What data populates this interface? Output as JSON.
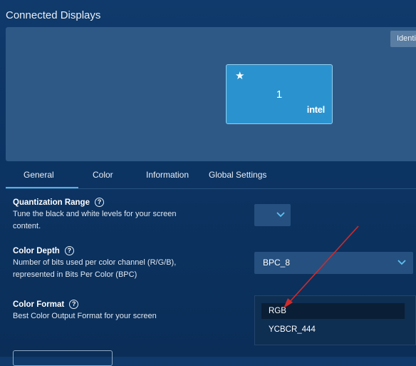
{
  "header": {
    "title": "Connected Displays"
  },
  "preview": {
    "identify_label": "Identify",
    "display": {
      "number": "1",
      "brand": "intel",
      "primary_icon": "star-icon"
    }
  },
  "tabs": [
    {
      "label": "General",
      "active": true
    },
    {
      "label": "Color",
      "active": false
    },
    {
      "label": "Information",
      "active": false
    },
    {
      "label": "Global Settings",
      "active": false
    }
  ],
  "settings": {
    "quantization": {
      "title": "Quantization Range",
      "description": "Tune the black and white levels for your screen content.",
      "value": ""
    },
    "color_depth": {
      "title": "Color Depth",
      "description": "Number of bits used per color channel (R/G/B), represented in Bits Per Color (BPC)",
      "value": "BPC_8"
    },
    "color_format": {
      "title": "Color Format",
      "description": "Best Color Output Format for your screen",
      "options": [
        "RGB",
        "YCBCR_444"
      ],
      "highlighted": "RGB"
    }
  },
  "colors": {
    "accent": "#4fb3ea",
    "card": "#2a93cf",
    "annotation_arrow": "#d12a2a"
  }
}
